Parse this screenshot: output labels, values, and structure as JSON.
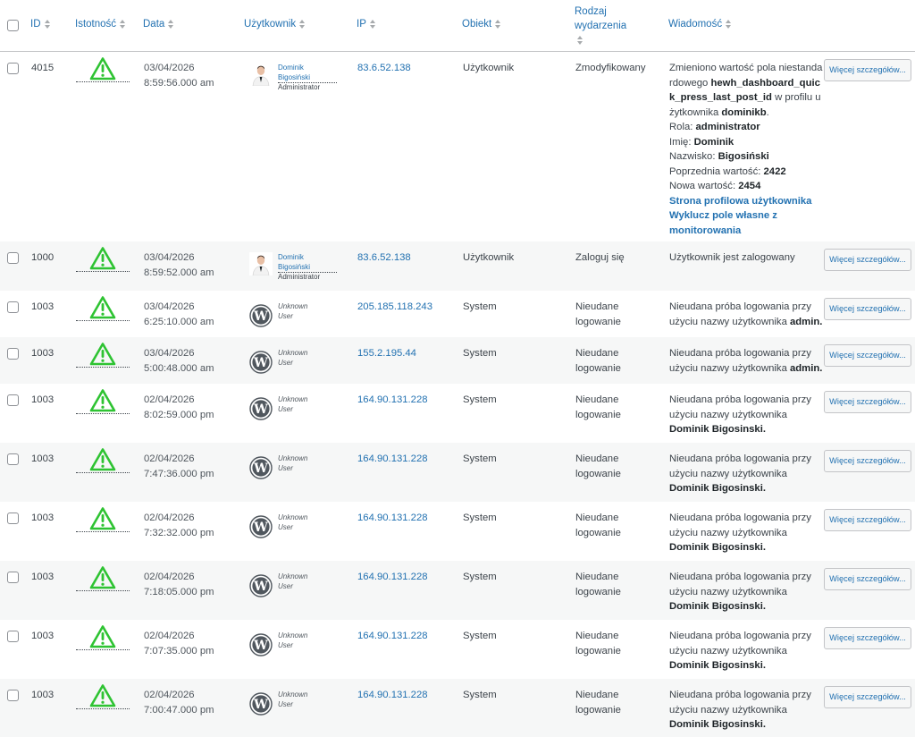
{
  "columns": {
    "id": "ID",
    "severity": "Istotność",
    "date": "Data",
    "user": "Użytkownik",
    "ip": "IP",
    "object": "Obiekt",
    "event_type_line1": "Rodzaj",
    "event_type_line2": "wydarzenia",
    "message": "Wiadomość"
  },
  "details_label": "Więcej szczegółów...",
  "colors": {
    "accent": "#2271b1",
    "warning": "#2ec332"
  },
  "rows": [
    {
      "id": "4015",
      "date": "03/04/2026",
      "time": "8:59:56.000 am",
      "user_first": "Dominik",
      "user_last": "Bigosiński",
      "role": "Administrator",
      "ip": "83.6.52.138",
      "object": "Użytkownik",
      "event": "Zmodyfikowany",
      "msg": {
        "t1": "Zmieniono wartość pola niestandardowego",
        "field": "hewh_dashboard_quick_press_last_post_id",
        "t2": "w profilu użytkownika",
        "user": "dominikb",
        "role_label": "Rola:",
        "role": "administrator",
        "first_label": "Imię:",
        "first": "Dominik",
        "last_label": "Nazwisko:",
        "last": "Bigosiński",
        "prev_label": "Poprzednia wartość:",
        "prev": "2422",
        "new_label": "Nowa wartość:",
        "new": "2454",
        "link1": "Strona profilowa użytkownika",
        "link2": "Wyklucz pole własne z monitorowania"
      }
    },
    {
      "id": "1000",
      "date": "03/04/2026",
      "time": "8:59:52.000 am",
      "user_first": "Dominik",
      "user_last": "Bigosiński",
      "role": "Administrator",
      "ip": "83.6.52.138",
      "object": "Użytkownik",
      "event": "Zaloguj się",
      "msg": "Użytkownik jest zalogowany"
    },
    {
      "id": "1003",
      "date": "03/04/2026",
      "time": "6:25:10.000 am",
      "user1": "Unknown",
      "user2": "User",
      "ip": "205.185.118.243",
      "object": "System",
      "event1": "Nieudane",
      "event2": "logowanie",
      "msg_pre": "Nieudana próba logowania przy użyciu nazwy użytkownika",
      "msg_user": "admin."
    },
    {
      "id": "1003",
      "date": "03/04/2026",
      "time": "5:00:48.000 am",
      "user1": "Unknown",
      "user2": "User",
      "ip": "155.2.195.44",
      "object": "System",
      "event1": "Nieudane",
      "event2": "logowanie",
      "msg_pre": "Nieudana próba logowania przy użyciu nazwy użytkownika",
      "msg_user": "admin."
    },
    {
      "id": "1003",
      "date": "02/04/2026",
      "time": "8:02:59.000 pm",
      "user1": "Unknown",
      "user2": "User",
      "ip": "164.90.131.228",
      "object": "System",
      "event1": "Nieudane",
      "event2": "logowanie",
      "msg_pre": "Nieudana próba logowania przy użyciu nazwy użytkownika",
      "msg_user": "Dominik Bigosinski."
    },
    {
      "id": "1003",
      "date": "02/04/2026",
      "time": "7:47:36.000 pm",
      "user1": "Unknown",
      "user2": "User",
      "ip": "164.90.131.228",
      "object": "System",
      "event1": "Nieudane",
      "event2": "logowanie",
      "msg_pre": "Nieudana próba logowania przy użyciu nazwy użytkownika",
      "msg_user": "Dominik Bigosinski."
    },
    {
      "id": "1003",
      "date": "02/04/2026",
      "time": "7:32:32.000 pm",
      "user1": "Unknown",
      "user2": "User",
      "ip": "164.90.131.228",
      "object": "System",
      "event1": "Nieudane",
      "event2": "logowanie",
      "msg_pre": "Nieudana próba logowania przy użyciu nazwy użytkownika",
      "msg_user": "Dominik Bigosinski."
    },
    {
      "id": "1003",
      "date": "02/04/2026",
      "time": "7:18:05.000 pm",
      "user1": "Unknown",
      "user2": "User",
      "ip": "164.90.131.228",
      "object": "System",
      "event1": "Nieudane",
      "event2": "logowanie",
      "msg_pre": "Nieudana próba logowania przy użyciu nazwy użytkownika",
      "msg_user": "Dominik Bigosinski."
    },
    {
      "id": "1003",
      "date": "02/04/2026",
      "time": "7:07:35.000 pm",
      "user1": "Unknown",
      "user2": "User",
      "ip": "164.90.131.228",
      "object": "System",
      "event1": "Nieudane",
      "event2": "logowanie",
      "msg_pre": "Nieudana próba logowania przy użyciu nazwy użytkownika",
      "msg_user": "Dominik Bigosinski."
    },
    {
      "id": "1003",
      "date": "02/04/2026",
      "time": "7:00:47.000 pm",
      "user1": "Unknown",
      "user2": "User",
      "ip": "164.90.131.228",
      "object": "System",
      "event1": "Nieudane",
      "event2": "logowanie",
      "msg_pre": "Nieudana próba logowania przy użyciu nazwy użytkownika",
      "msg_user": "Dominik Bigosinski."
    }
  ]
}
